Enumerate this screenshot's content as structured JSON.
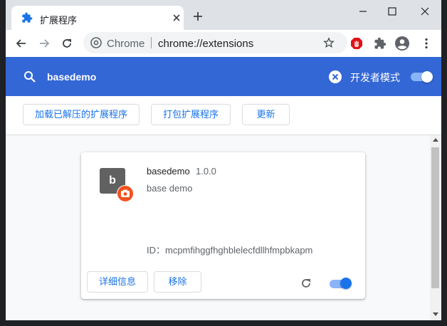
{
  "tab": {
    "title": "扩展程序",
    "icon": "puzzle-icon"
  },
  "window_controls": [
    "minimize-icon",
    "maximize-icon",
    "close-icon"
  ],
  "omnibox": {
    "host": "Chrome",
    "url": "chrome://extensions"
  },
  "toolbar_icons": [
    "back-icon",
    "forward-icon",
    "reload-icon",
    "bookmark-star-icon",
    "adblock-extension-icon",
    "extensions-puzzle-icon",
    "profile-avatar-icon",
    "menu-kebab-icon"
  ],
  "header": {
    "search_text": "basedemo",
    "dev_mode_label": "开发者模式",
    "dev_mode_on": true
  },
  "actions": {
    "load_unpacked": "加载已解压的扩展程序",
    "pack_extension": "打包扩展程序",
    "update": "更新"
  },
  "extension": {
    "icon_letter": "b",
    "name": "basedemo",
    "version": "1.0.0",
    "description": "base demo",
    "id_text": "ID：mcpmfihggfhghblelecfdllhfmpbkapm",
    "details_label": "详细信息",
    "remove_label": "移除",
    "enabled": true
  },
  "colors": {
    "accent_blue": "#3367d6",
    "link_blue": "#1a73e8",
    "badge_orange": "#f4511e"
  }
}
